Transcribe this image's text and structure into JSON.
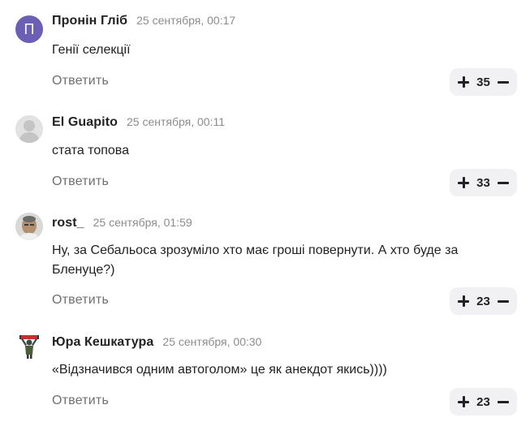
{
  "reply_label": "Ответить",
  "comments": [
    {
      "avatar_letter": "П",
      "author": "Пронін Гліб",
      "date": "25 сентября, 00:17",
      "text": "Генії селекції",
      "votes": "35"
    },
    {
      "author": "El Guapito",
      "date": "25 сентября, 00:11",
      "text": "стата топова",
      "votes": "33"
    },
    {
      "author": "rost_",
      "date": "25 сентября, 01:59",
      "text": "Ну, за Себальоса зрозуміло хто має гроші повернути. А хто буде за Бленуце?)",
      "votes": "23"
    },
    {
      "author": "Юра Кешкатура",
      "date": "25 сентября, 00:30",
      "text": "«Відзначився одним автоголом» це як анекдот якись))))",
      "votes": "23"
    }
  ]
}
